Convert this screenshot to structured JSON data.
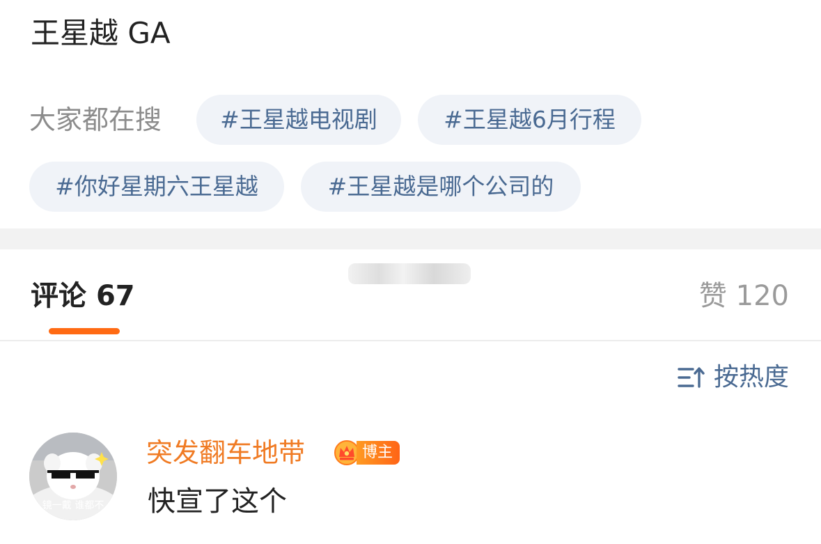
{
  "post": {
    "text": "王星越 GA"
  },
  "trending": {
    "label": "大家都在搜",
    "tags": [
      "#王星越电视剧",
      "#王星越6月行程",
      "#你好星期六王星越",
      "#王星越是哪个公司的"
    ],
    "tag_bg_color": "#f0f3f8",
    "tag_text_color": "#4a6a92"
  },
  "tabs": {
    "comments_label": "评论",
    "comments_count": "67",
    "likes_label": "赞",
    "likes_count": "120",
    "active_underline_color": "#ff6a13"
  },
  "sort": {
    "label": "按热度",
    "icon": "sort-icon"
  },
  "comments": [
    {
      "username": "突发翻车地带",
      "badge": "博主",
      "badge_icon": "crown-icon",
      "avatar_caption": "镜一戴 谁都不",
      "text": "快宣了这个",
      "username_color": "#f07b24"
    }
  ]
}
